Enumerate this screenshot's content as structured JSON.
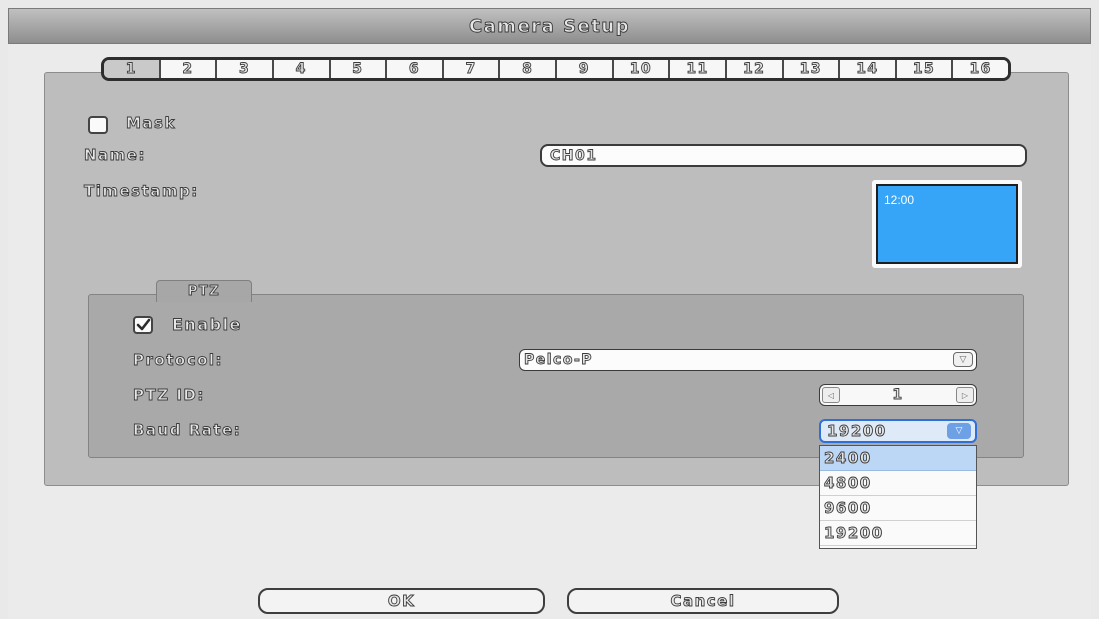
{
  "window": {
    "title": "Camera Setup"
  },
  "channel_tabs": [
    "1",
    "2",
    "3",
    "4",
    "5",
    "6",
    "7",
    "8",
    "9",
    "10",
    "11",
    "12",
    "13",
    "14",
    "15",
    "16"
  ],
  "active_tab": "1",
  "general": {
    "mask_label": "Mask",
    "mask_checked": false,
    "name_label": "Name:",
    "name_value": "CH01",
    "timestamp_label": "Timestamp:",
    "timestamp_preview_text": "12:00",
    "preview_color": "#36a4f7"
  },
  "ptz": {
    "section_title": "PTZ",
    "enable_label": "Enable",
    "enable_checked": true,
    "protocol_label": "Protocol:",
    "protocol_value": "Pelco-P",
    "ptz_id_label": "PTZ ID:",
    "ptz_id_value": "1",
    "baud_rate_label": "Baud Rate:",
    "baud_rate_value": "19200",
    "baud_rate_options": [
      "2400",
      "4800",
      "9600",
      "19200"
    ],
    "baud_rate_highlighted": "2400"
  },
  "buttons": {
    "ok_label": "OK",
    "cancel_label": "Cancel"
  },
  "colors": {
    "accent": "#2f6fd8",
    "highlight": "#bcd6f6"
  }
}
